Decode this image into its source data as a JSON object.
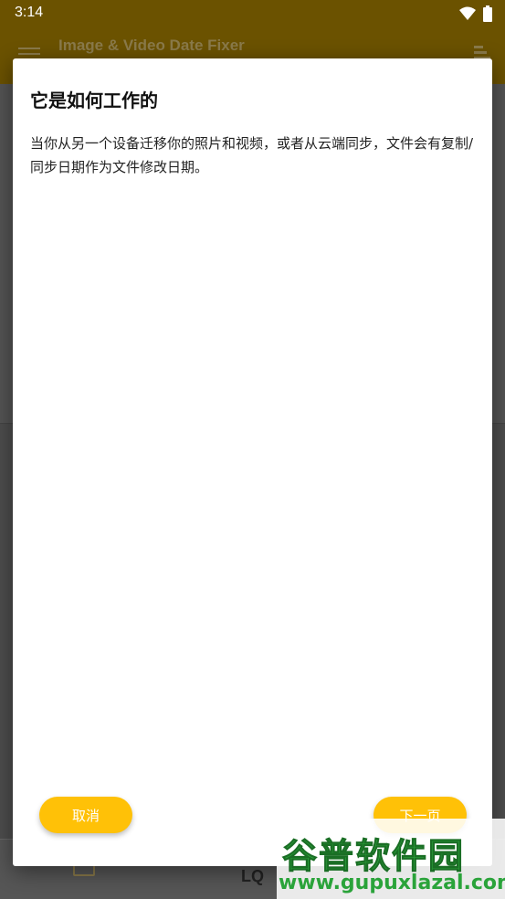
{
  "status_bar": {
    "time": "3:14"
  },
  "app_bar": {
    "title": "Image & Video Date Fixer"
  },
  "dialog": {
    "title": "它是如何工作的",
    "body": "当你从另一个设备迁移你的照片和视频，或者从云端同步，文件会有复制/同步日期作为文件修改日期。",
    "cancel_label": "取消",
    "next_label": "下一页"
  },
  "bottom_nav": {
    "item2_label": "LQ"
  },
  "watermark": {
    "logo_text": "谷普软件园",
    "url_text": "www.gupuxlazal.com"
  },
  "colors": {
    "accent": "#ffc107",
    "app_bar": "#6b5200",
    "scrim": "#4d4d4d"
  }
}
